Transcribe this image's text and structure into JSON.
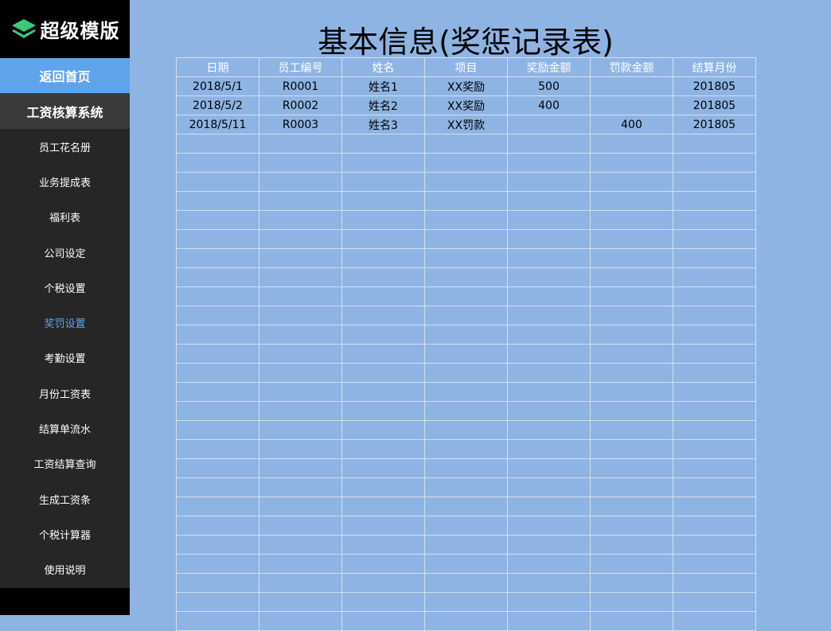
{
  "brand": {
    "logo_text": "超级模版",
    "logo_icon": "layers-icon"
  },
  "sidebar": {
    "home_label": "返回首页",
    "system_title": "工资核算系统",
    "items": [
      {
        "label": "员工花名册"
      },
      {
        "label": "业务提成表"
      },
      {
        "label": "福利表"
      },
      {
        "label": "公司设定"
      },
      {
        "label": "个税设置"
      },
      {
        "label": "奖罚设置",
        "active": true
      },
      {
        "label": "考勤设置"
      },
      {
        "label": "月份工资表"
      },
      {
        "label": "结算单流水"
      },
      {
        "label": "工资结算查询"
      },
      {
        "label": "生成工资条"
      },
      {
        "label": "个税计算器"
      },
      {
        "label": "使用说明"
      }
    ],
    "active_color": "#5fa3ea"
  },
  "main": {
    "title": "基本信息(奖惩记录表)",
    "background_color": "#8eb4e3",
    "table": {
      "headers": [
        "日期",
        "员工编号",
        "姓名",
        "项目",
        "奖励金额",
        "罚款金额",
        "结算月份"
      ],
      "rows": [
        [
          "2018/5/1",
          "R0001",
          "姓名1",
          "XX奖励",
          "500",
          "",
          "201805"
        ],
        [
          "2018/5/2",
          "R0002",
          "姓名2",
          "XX奖励",
          "400",
          "",
          "201805"
        ],
        [
          "2018/5/11",
          "R0003",
          "姓名3",
          "XX罚款",
          "",
          "400",
          "201805"
        ]
      ],
      "empty_rows": 26
    }
  }
}
